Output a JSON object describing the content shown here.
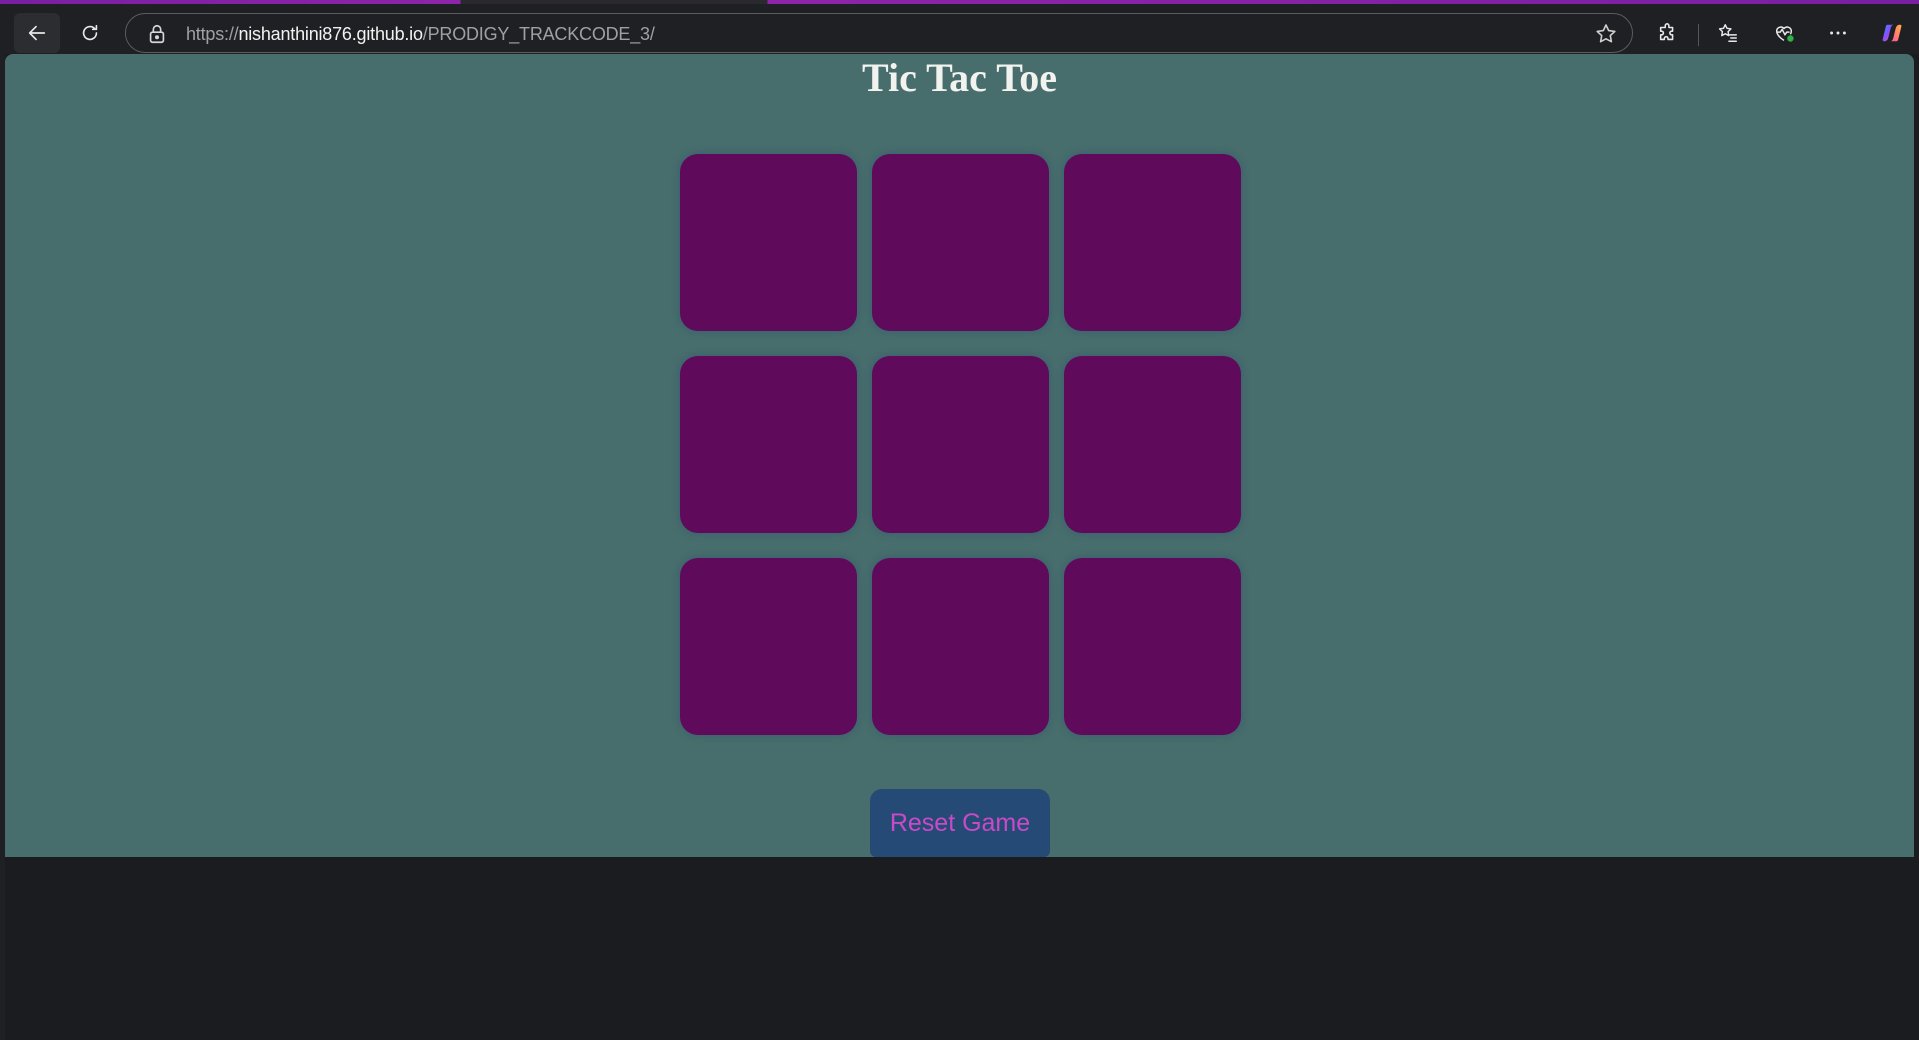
{
  "browser": {
    "url_prefix": "https://",
    "url_host": "nishanthini876.github.io",
    "url_path": "/PRODIGY_TRACKCODE_3/",
    "icons": {
      "back": "arrow-left-icon",
      "refresh": "refresh-icon",
      "lock": "lock-icon",
      "favorite": "star-icon",
      "extensions": "puzzle-icon",
      "favorites": "favorites-list-icon",
      "health": "browser-essentials-icon",
      "more": "more-dots-icon",
      "copilot": "copilot-icon"
    }
  },
  "game": {
    "title": "Tic Tac Toe",
    "cells": [
      "",
      "",
      "",
      "",
      "",
      "",
      "",
      "",
      ""
    ],
    "reset_label": "Reset Game"
  },
  "colors": {
    "page_background": "#476d6d",
    "cell_background": "#5f0a5b",
    "reset_background": "#264a76",
    "reset_text": "#c84ac8",
    "title_text": "#f2f2ee",
    "browser_chrome": "#1f2023",
    "accent": "#8e24aa"
  }
}
